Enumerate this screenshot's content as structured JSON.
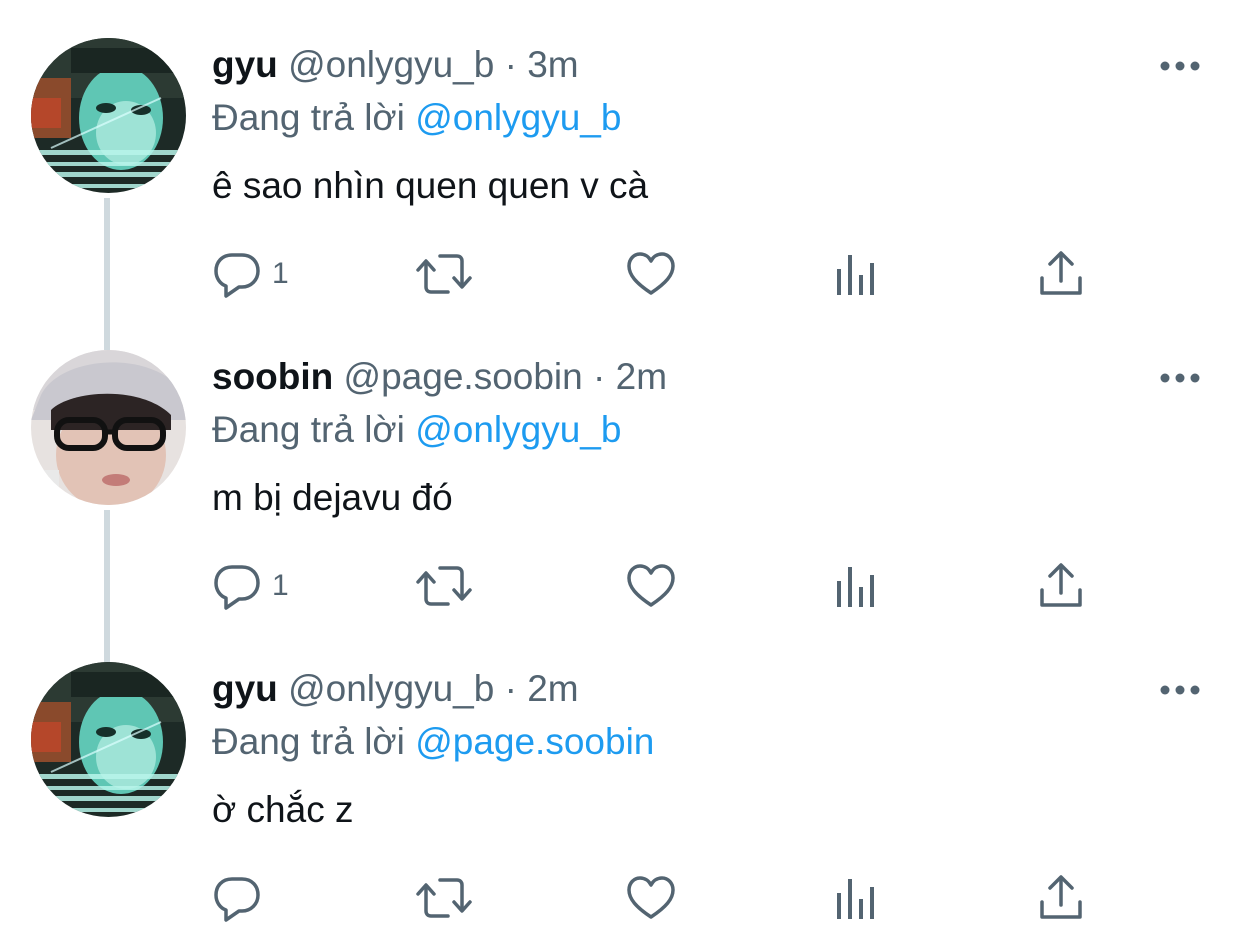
{
  "thread": {
    "reply_prefix": "Đang trả lời",
    "tweets": [
      {
        "name": "gyu",
        "handle": "@onlygyu_b",
        "separator": "·",
        "time": "3m",
        "reply_to": "@onlygyu_b",
        "text": "ê sao nhìn quen quen v cà",
        "reply_count": "1",
        "avatar": "avatar-gyu"
      },
      {
        "name": "soobin",
        "handle": "@page.soobin",
        "separator": "·",
        "time": "2m",
        "reply_to": "@onlygyu_b",
        "text": "m bị dejavu đó",
        "reply_count": "1",
        "avatar": "avatar-soobin"
      },
      {
        "name": "gyu",
        "handle": "@onlygyu_b",
        "separator": "·",
        "time": "2m",
        "reply_to": "@page.soobin",
        "text": "ờ chắc z",
        "reply_count": "",
        "avatar": "avatar-gyu"
      }
    ]
  },
  "icons": {
    "more": "more-dots-icon",
    "reply": "reply-bubble-icon",
    "retweet": "retweet-icon",
    "like": "heart-icon",
    "analytics": "analytics-bars-icon",
    "share": "share-upload-icon"
  },
  "colors": {
    "text": "#0f1419",
    "secondary": "#536471",
    "mention": "#1d9bf0",
    "thread_line": "#cfd9de"
  }
}
